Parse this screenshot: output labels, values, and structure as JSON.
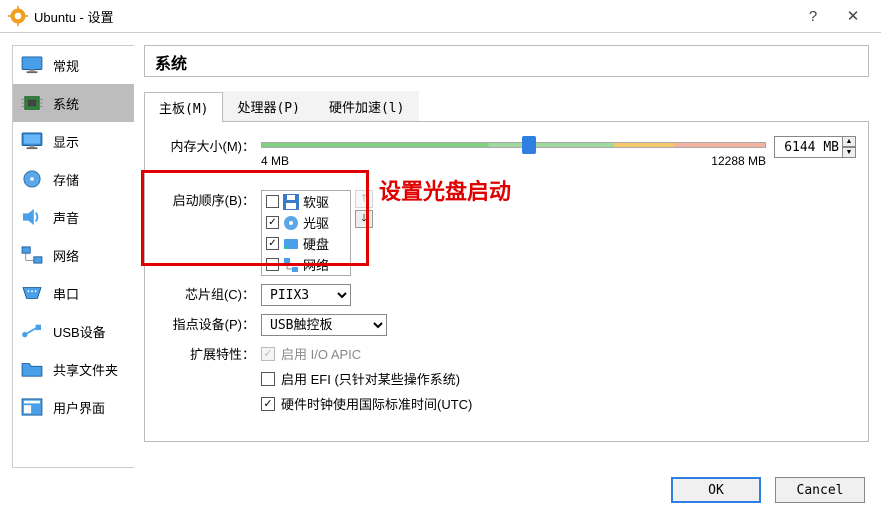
{
  "window": {
    "title": "Ubuntu - 设置"
  },
  "sidebar": {
    "items": [
      {
        "label": "常规"
      },
      {
        "label": "系统"
      },
      {
        "label": "显示"
      },
      {
        "label": "存储"
      },
      {
        "label": "声音"
      },
      {
        "label": "网络"
      },
      {
        "label": "串口"
      },
      {
        "label": "USB设备"
      },
      {
        "label": "共享文件夹"
      },
      {
        "label": "用户界面"
      }
    ]
  },
  "section_title": "系统",
  "tabs": {
    "motherboard": "主板(M)",
    "processor": "处理器(P)",
    "accel": "硬件加速(l)"
  },
  "memory": {
    "label": "内存大小(M)：",
    "min": "4 MB",
    "max": "12288 MB",
    "value": "6144 MB"
  },
  "boot": {
    "label": "启动顺序(B)：",
    "items": [
      {
        "label": "软驱",
        "checked": false,
        "icon": "floppy"
      },
      {
        "label": "光驱",
        "checked": true,
        "icon": "cd"
      },
      {
        "label": "硬盘",
        "checked": true,
        "icon": "hdd"
      },
      {
        "label": "网络",
        "checked": false,
        "icon": "net"
      }
    ]
  },
  "callout": "设置光盘启动",
  "chipset": {
    "label": "芯片组(C)：",
    "value": "PIIX3"
  },
  "pointing": {
    "label": "指点设备(P)：",
    "value": "USB触控板"
  },
  "ext": {
    "label": "扩展特性：",
    "io_apic": "启用 I/O APIC",
    "efi": "启用 EFI (只针对某些操作系统)",
    "utc": "硬件时钟使用国际标准时间(UTC)"
  },
  "buttons": {
    "ok": "OK",
    "cancel": "Cancel"
  }
}
